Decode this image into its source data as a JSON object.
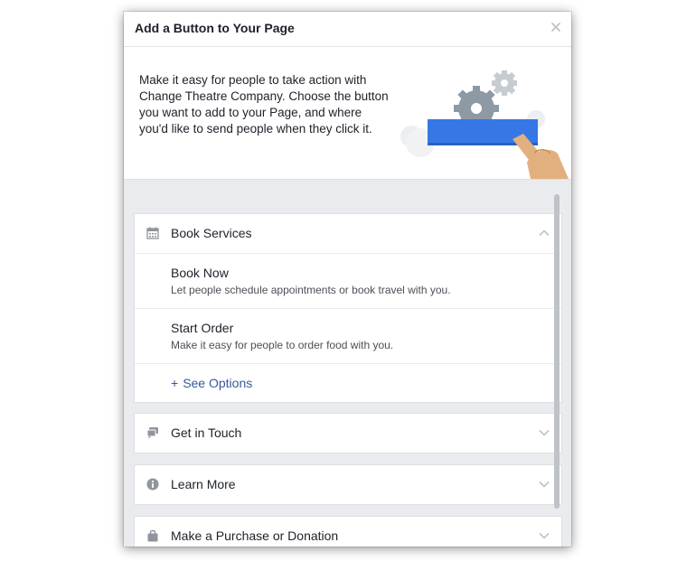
{
  "dialog": {
    "title": "Add a Button to Your Page",
    "close_icon": "close-icon"
  },
  "intro": {
    "text": "Make it easy for people to take action with Change Theatre Company. Choose the button you want to add to your Page, and where you'd like to send people when they click it."
  },
  "sections": [
    {
      "title": "Book Services",
      "icon": "calendar-icon",
      "expanded": true,
      "options": [
        {
          "title": "Book Now",
          "description": "Let people schedule appointments or book travel with you."
        },
        {
          "title": "Start Order",
          "description": "Make it easy for people to order food with you."
        }
      ],
      "see_options_plus": "+",
      "see_options_label": "See Options"
    },
    {
      "title": "Get in Touch",
      "icon": "chat-icon",
      "expanded": false
    },
    {
      "title": "Learn More",
      "icon": "info-icon",
      "expanded": false
    },
    {
      "title": "Make a Purchase or Donation",
      "icon": "shopping-bag-icon",
      "expanded": false
    }
  ],
  "colors": {
    "accent_blue": "#3578e5",
    "link": "#365899",
    "gear": "#8d9aa6",
    "hand": "#e2b07f"
  }
}
